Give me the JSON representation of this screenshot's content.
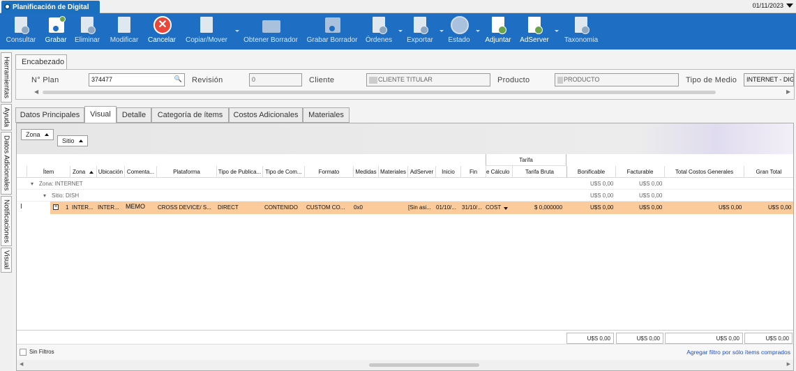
{
  "window": {
    "title": "Planificación de Digital",
    "date": "01/11/2023"
  },
  "toolbar": [
    {
      "label": "Consultar",
      "enabled": false
    },
    {
      "label": "Grabar",
      "enabled": true
    },
    {
      "label": "Eliminar",
      "enabled": false
    },
    {
      "label": "Modificar",
      "enabled": false
    },
    {
      "label": "Cancelar",
      "enabled": true
    },
    {
      "label": "Copiar/Mover",
      "enabled": false
    },
    {
      "label": "Obtener Borrador",
      "enabled": false
    },
    {
      "label": "Grabar Borrador",
      "enabled": false
    },
    {
      "label": "Órdenes",
      "enabled": false
    },
    {
      "label": "Exportar",
      "enabled": false
    },
    {
      "label": "Estado",
      "enabled": false
    },
    {
      "label": "Adjuntar",
      "enabled": true
    },
    {
      "label": "AdServer",
      "enabled": true
    },
    {
      "label": "Taxonomia",
      "enabled": false
    }
  ],
  "sidetabs": [
    "Herramientas",
    "Ayuda",
    "Datos Adicionales",
    "Notificaciones",
    "Visual"
  ],
  "encabezado": {
    "tab": "Encabezado",
    "plan_label": "N° Plan",
    "plan_value": "374477",
    "revision_label": "Revisión",
    "revision_value": "0",
    "cliente_label": "Cliente",
    "cliente_value": "CLIENTE TITULAR",
    "producto_label": "Producto",
    "producto_value": "PRODUCTO",
    "medio_label": "Tipo de Medio",
    "medio_value": "INTERNET - DIGI"
  },
  "tabs": [
    "Datos Principales",
    "Visual",
    "Detalle",
    "Categoría de ítems",
    "Costos Adicionales",
    "Materiales"
  ],
  "group_buttons": {
    "zona": "Zona",
    "sitio": "Sitio"
  },
  "grid": {
    "group_header": "Tarifa",
    "columns": [
      "Ítem",
      "Zona",
      "Ubicación",
      "Comenta...",
      "Plataforma",
      "Tipo de Publica...",
      "Tipo de Com...",
      "Formato",
      "Medidas",
      "Materiales",
      "AdServer",
      "Inicio",
      "Fin",
      "e Cálculo",
      "Tarifa Bruta",
      "Bonificable",
      "Facturable",
      "Total Costos Generales",
      "Gran Total"
    ],
    "group_zona": {
      "label": "Zona: INTERNET",
      "bonificable": "U$S 0,00",
      "facturable": "U$S 0,00"
    },
    "group_sitio": {
      "label": "Sitio: DISH",
      "bonificable": "U$S 0,00",
      "facturable": "U$S 0,00"
    },
    "row": {
      "item": "1",
      "zona": "INTER...",
      "ubicacion": "INTER...",
      "comentario": "MEMO",
      "plataforma": "CROSS DEVICE/ S...",
      "tipo_publicacion": "DIRECT",
      "tipo_compra": "CONTENIDO",
      "formato": "CUSTOM CO...",
      "medidas": "0x0",
      "adserver": "[Sin asi...",
      "inicio": "01/10/...",
      "fin": "31/10/...",
      "calculo": "COST",
      "tarifa_bruta": "$ 0,000000",
      "bonificable": "U$S 0,00",
      "facturable": "U$S 0,00",
      "total_costos": "U$S 0,00",
      "gran_total": "U$S 0,00"
    },
    "totals": {
      "bonificable": "U$S 0,00",
      "facturable": "U$S 0,00",
      "total_costos": "U$S 0,00",
      "gran_total": "U$S 0,00"
    }
  },
  "filters": {
    "sin_filtros": "Sin Filtros",
    "link": "Agregar filtro por sólo ítems comprados"
  },
  "colors": {
    "toolbar": "#1e6fc3",
    "selected_row": "#fbcb9b",
    "link": "#1a4fd0"
  }
}
